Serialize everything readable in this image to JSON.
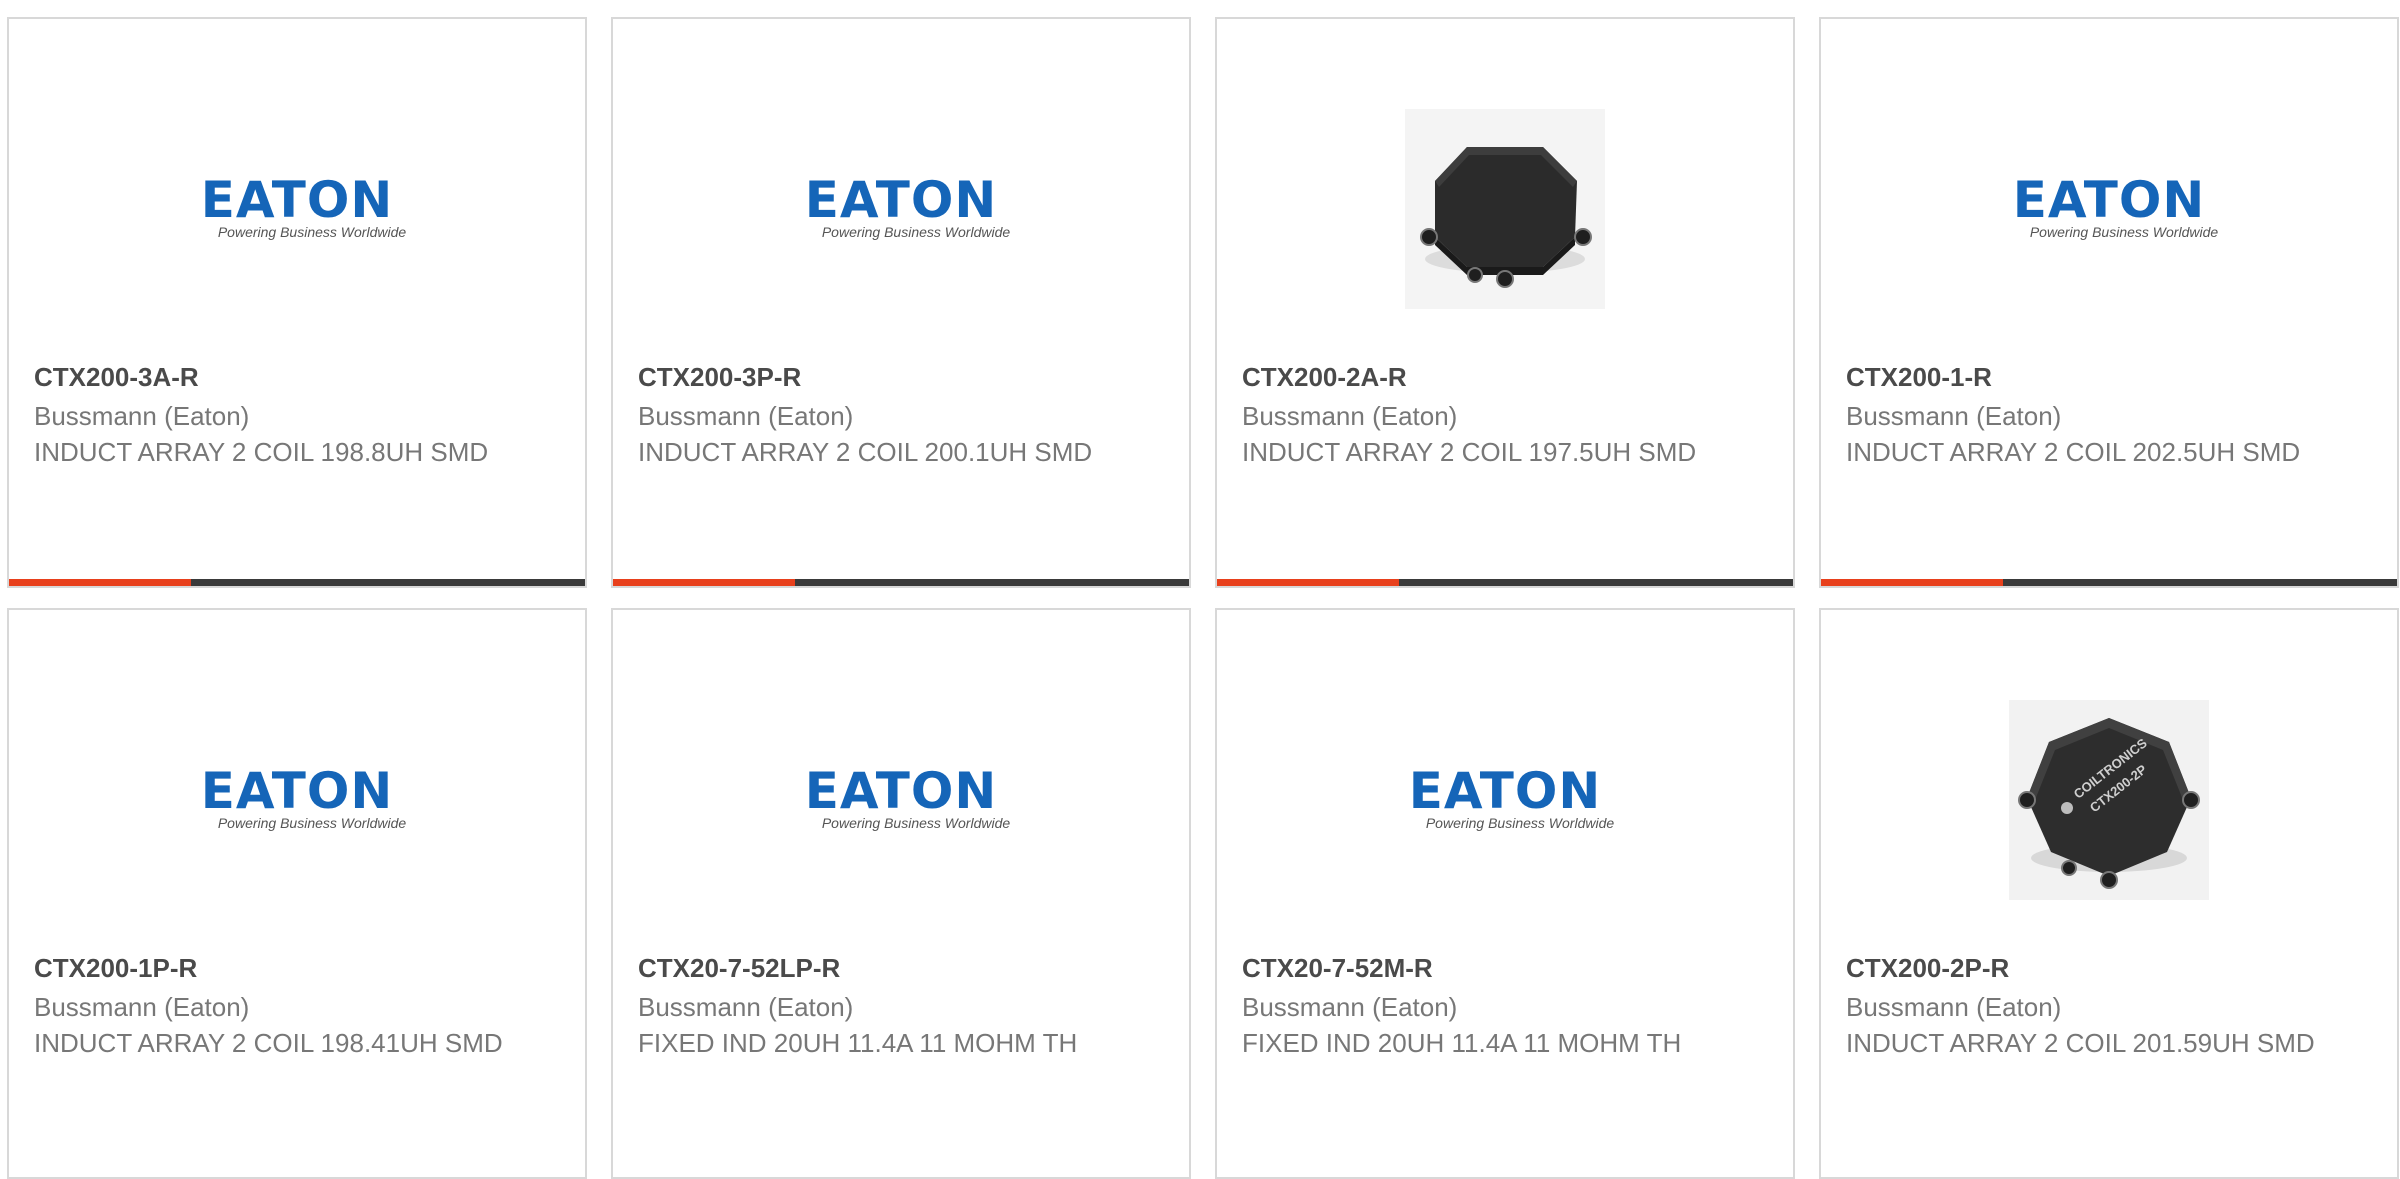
{
  "logo": {
    "word": "EATON",
    "tagline": "Powering Business Worldwide"
  },
  "colors": {
    "accent": "#e8401c",
    "bar": "#3a3a3a",
    "eaton_blue": "#1565b8"
  },
  "products": [
    {
      "part_number": "CTX200-3A-R",
      "manufacturer": "Bussmann (Eaton)",
      "description": "INDUCT ARRAY 2 COIL 198.8UH SMD",
      "image": "eaton-logo"
    },
    {
      "part_number": "CTX200-3P-R",
      "manufacturer": "Bussmann (Eaton)",
      "description": "INDUCT ARRAY 2 COIL 200.1UH SMD",
      "image": "eaton-logo"
    },
    {
      "part_number": "CTX200-2A-R",
      "manufacturer": "Bussmann (Eaton)",
      "description": "INDUCT ARRAY 2 COIL 197.5UH SMD",
      "image": "inductor-photo"
    },
    {
      "part_number": "CTX200-1-R",
      "manufacturer": "Bussmann (Eaton)",
      "description": "INDUCT ARRAY 2 COIL 202.5UH SMD",
      "image": "eaton-logo"
    },
    {
      "part_number": "CTX200-1P-R",
      "manufacturer": "Bussmann (Eaton)",
      "description": "INDUCT ARRAY 2 COIL 198.41UH SMD",
      "image": "eaton-logo"
    },
    {
      "part_number": "CTX20-7-52LP-R",
      "manufacturer": "Bussmann (Eaton)",
      "description": "FIXED IND 20UH 11.4A 11 MOHM TH",
      "image": "eaton-logo"
    },
    {
      "part_number": "CTX20-7-52M-R",
      "manufacturer": "Bussmann (Eaton)",
      "description": "FIXED IND 20UH 11.4A 11 MOHM TH",
      "image": "eaton-logo"
    },
    {
      "part_number": "CTX200-2P-R",
      "manufacturer": "Bussmann (Eaton)",
      "description": "INDUCT ARRAY 2 COIL 201.59UH SMD",
      "image": "inductor-photo-labeled"
    }
  ]
}
